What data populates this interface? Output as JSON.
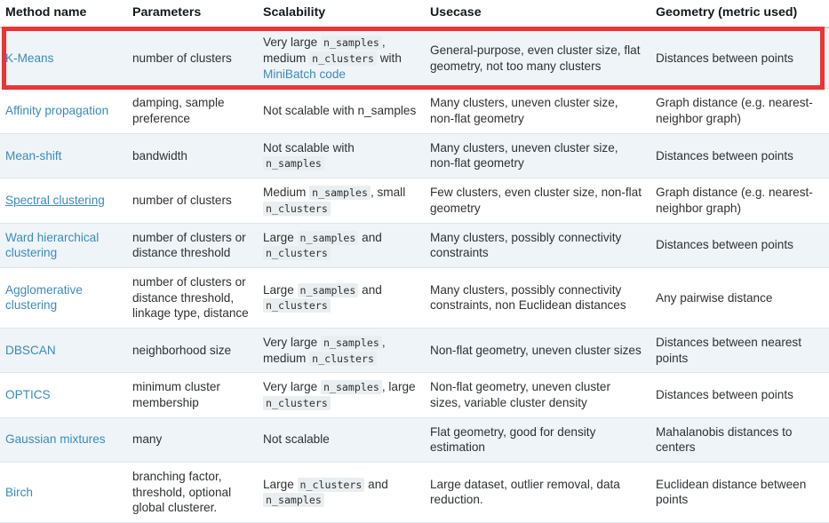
{
  "table": {
    "columns": [
      {
        "key": "method",
        "label": "Method name"
      },
      {
        "key": "parameters",
        "label": "Parameters"
      },
      {
        "key": "scalability",
        "label": "Scalability"
      },
      {
        "key": "usecase",
        "label": "Usecase"
      },
      {
        "key": "geometry",
        "label": "Geometry (metric used)"
      }
    ],
    "rows": [
      {
        "method": "K-Means",
        "method_is_link": true,
        "method_underlined": false,
        "parameters": "number of clusters",
        "scalability_parts": [
          {
            "t": "text",
            "v": "Very large "
          },
          {
            "t": "code",
            "v": "n_samples"
          },
          {
            "t": "text",
            "v": ", medium "
          },
          {
            "t": "code",
            "v": "n_clusters"
          },
          {
            "t": "text",
            "v": " with "
          },
          {
            "t": "link",
            "v": "MiniBatch code"
          }
        ],
        "usecase": "General-purpose, even cluster size, flat geometry, not too many clusters",
        "geometry": "Distances between points"
      },
      {
        "method": "Affinity propagation",
        "method_is_link": true,
        "method_underlined": false,
        "parameters": "damping, sample preference",
        "scalability_parts": [
          {
            "t": "text",
            "v": "Not scalable with "
          },
          {
            "t": "plain",
            "v": "n_samples"
          }
        ],
        "usecase": "Many clusters, uneven cluster size, non-flat geometry",
        "geometry": "Graph distance (e.g. nearest-neighbor graph)"
      },
      {
        "method": "Mean-shift",
        "method_is_link": true,
        "method_underlined": false,
        "parameters": "bandwidth",
        "scalability_parts": [
          {
            "t": "text",
            "v": "Not scalable with "
          },
          {
            "t": "code",
            "v": "n_samples"
          }
        ],
        "usecase": "Many clusters, uneven cluster size, non-flat geometry",
        "geometry": "Distances between points"
      },
      {
        "method": "Spectral clustering",
        "method_is_link": true,
        "method_underlined": true,
        "parameters": "number of clusters",
        "scalability_parts": [
          {
            "t": "text",
            "v": "Medium "
          },
          {
            "t": "code",
            "v": "n_samples"
          },
          {
            "t": "text",
            "v": ", small "
          },
          {
            "t": "code",
            "v": "n_clusters"
          }
        ],
        "usecase": "Few clusters, even cluster size, non-flat geometry",
        "geometry": "Graph distance (e.g. nearest-neighbor graph)"
      },
      {
        "method": "Ward hierarchical clustering",
        "method_is_link": true,
        "method_underlined": false,
        "parameters": "number of clusters or distance threshold",
        "scalability_parts": [
          {
            "t": "text",
            "v": "Large "
          },
          {
            "t": "code",
            "v": "n_samples"
          },
          {
            "t": "text",
            "v": " and "
          },
          {
            "t": "code",
            "v": "n_clusters"
          }
        ],
        "usecase": "Many clusters, possibly connectivity constraints",
        "geometry": "Distances between points"
      },
      {
        "method": "Agglomerative clustering",
        "method_is_link": true,
        "method_underlined": false,
        "parameters": "number of clusters or distance threshold, linkage type, distance",
        "scalability_parts": [
          {
            "t": "text",
            "v": "Large "
          },
          {
            "t": "code",
            "v": "n_samples"
          },
          {
            "t": "text",
            "v": " and "
          },
          {
            "t": "code",
            "v": "n_clusters"
          }
        ],
        "usecase": "Many clusters, possibly connectivity constraints, non Euclidean distances",
        "geometry": "Any pairwise distance"
      },
      {
        "method": "DBSCAN",
        "method_is_link": true,
        "method_underlined": false,
        "parameters": "neighborhood size",
        "scalability_parts": [
          {
            "t": "text",
            "v": "Very large "
          },
          {
            "t": "code",
            "v": "n_samples"
          },
          {
            "t": "text",
            "v": ", medium "
          },
          {
            "t": "code",
            "v": "n_clusters"
          }
        ],
        "usecase": "Non-flat geometry, uneven cluster sizes",
        "geometry": "Distances between nearest points"
      },
      {
        "method": "OPTICS",
        "method_is_link": true,
        "method_underlined": false,
        "parameters": "minimum cluster membership",
        "scalability_parts": [
          {
            "t": "text",
            "v": "Very large "
          },
          {
            "t": "code",
            "v": "n_samples"
          },
          {
            "t": "text",
            "v": ", large "
          },
          {
            "t": "code",
            "v": "n_clusters"
          }
        ],
        "usecase": "Non-flat geometry, uneven cluster sizes, variable cluster density",
        "geometry": "Distances between points"
      },
      {
        "method": "Gaussian mixtures",
        "method_is_link": true,
        "method_underlined": false,
        "parameters": "many",
        "scalability_parts": [
          {
            "t": "text",
            "v": "Not scalable"
          }
        ],
        "usecase": "Flat geometry, good for density estimation",
        "geometry": "Mahalanobis distances to centers"
      },
      {
        "method": "Birch",
        "method_is_link": true,
        "method_underlined": false,
        "parameters": "branching factor, threshold, optional global clusterer.",
        "scalability_parts": [
          {
            "t": "text",
            "v": "Large "
          },
          {
            "t": "code",
            "v": "n_clusters"
          },
          {
            "t": "text",
            "v": " and "
          },
          {
            "t": "code",
            "v": "n_samples"
          }
        ],
        "usecase": "Large dataset, outlier removal, data reduction.",
        "geometry": "Euclidean distance between points"
      }
    ]
  },
  "annotation": {
    "highlight_row_index": 0,
    "highlight_color": "#ed3434"
  },
  "colors": {
    "link": "#3a8bbb",
    "header_text": "#12181d",
    "body_text": "#2f3134",
    "row_odd_bg": "#eef4f7",
    "row_even_bg": "#ffffff",
    "row_border": "#dfe6eb",
    "header_border": "#b8d4e6",
    "code_bg": "#e9eef1",
    "highlight": "#ed3434"
  }
}
